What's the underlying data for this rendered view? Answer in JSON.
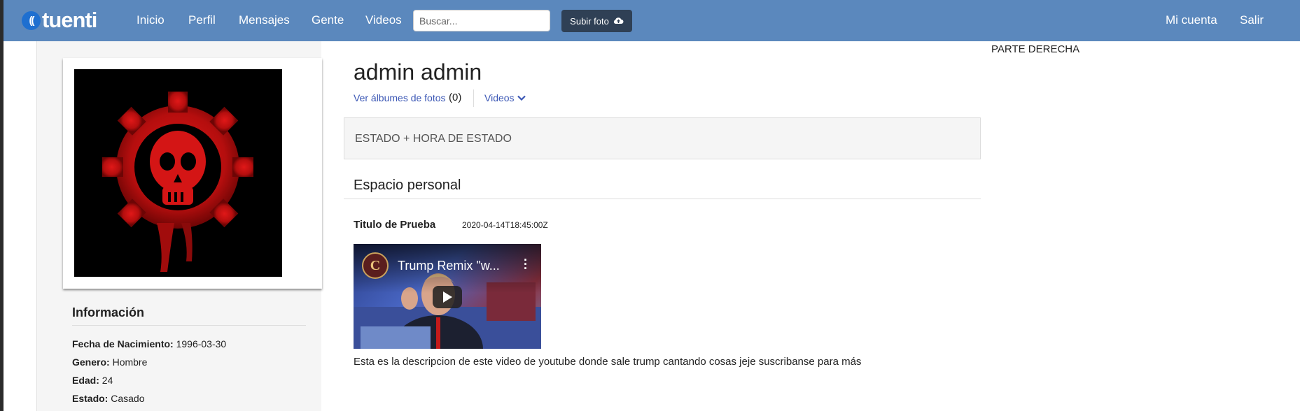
{
  "nav": {
    "logo_text": "tuenti",
    "links": [
      "Inicio",
      "Perfil",
      "Mensajes",
      "Gente",
      "Videos"
    ],
    "search_placeholder": "Buscar...",
    "upload_label": "Subir foto",
    "account_label": "Mi cuenta",
    "logout_label": "Salir"
  },
  "profile": {
    "name": "admin admin",
    "albums_label": "Ver álbumes de fotos",
    "albums_count": "(0)",
    "videos_label": "Videos",
    "status": "ESTADO + HORA DE ESTADO"
  },
  "info": {
    "title": "Información",
    "rows": [
      {
        "label": "Fecha de Nacimiento:",
        "value": "1996-03-30"
      },
      {
        "label": "Genero:",
        "value": "Hombre"
      },
      {
        "label": "Edad:",
        "value": "24"
      },
      {
        "label": "Estado:",
        "value": "Casado"
      }
    ]
  },
  "personal": {
    "section_title": "Espacio personal",
    "post": {
      "title": "Titulo de Prueba",
      "date": "2020-04-14T18:45:00Z",
      "video_title": "Trump Remix \"w...",
      "description": "Esta es la descripcion de este video de youtube donde sale trump cantando cosas jeje suscribanse para más"
    }
  },
  "right_panel": {
    "text": "PARTE DERECHA"
  },
  "colors": {
    "navbar": "#5b88bd",
    "link": "#3b57b5",
    "upload_button": "#2f4055"
  }
}
